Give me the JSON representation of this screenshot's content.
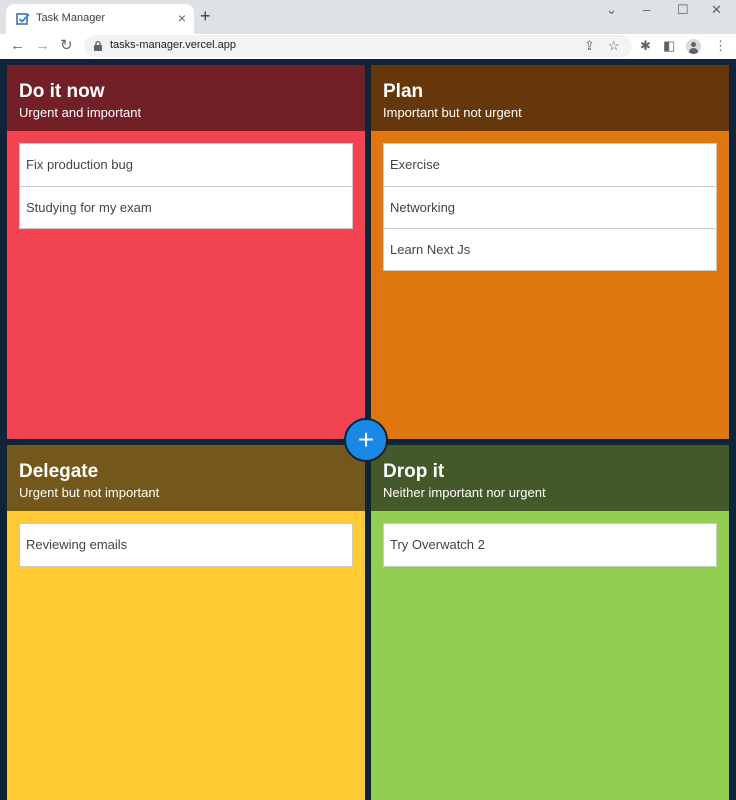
{
  "browser": {
    "tab_title": "Task Manager",
    "tab_close": "×",
    "new_tab": "+",
    "url": "tasks-manager.vercel.app",
    "icons": {
      "back": "←",
      "forward": "→",
      "reload": "↻",
      "share": "⇪",
      "bookmark": "☆",
      "extensions": "✱",
      "sidepanel": "◧",
      "menu": "⋮",
      "win_minimize": "–",
      "win_maximize": "☐",
      "win_close": "✕",
      "tab_search": "⌄"
    }
  },
  "quadrants": [
    {
      "title": "Do it now",
      "subtitle": "Urgent and important",
      "tasks": [
        "Fix production bug",
        "Studying for my exam"
      ]
    },
    {
      "title": "Plan",
      "subtitle": "Important but not urgent",
      "tasks": [
        "Exercise",
        "Networking",
        "Learn Next Js"
      ]
    },
    {
      "title": "Delegate",
      "subtitle": "Urgent but not important",
      "tasks": [
        "Reviewing emails"
      ]
    },
    {
      "title": "Drop it",
      "subtitle": "Neither important nor urgent",
      "tasks": [
        "Try Overwatch 2"
      ]
    }
  ],
  "add_button_label": "+",
  "colors": {
    "background": "#0f2438",
    "do_header": "#731f28",
    "do_body": "#f24352",
    "plan_header": "#66370a",
    "plan_body": "#df760f",
    "delegate_header": "#74581b",
    "delegate_body": "#ffca33",
    "drop_header": "#43592a",
    "drop_body": "#92ce51",
    "add_button": "#1a89e6"
  }
}
